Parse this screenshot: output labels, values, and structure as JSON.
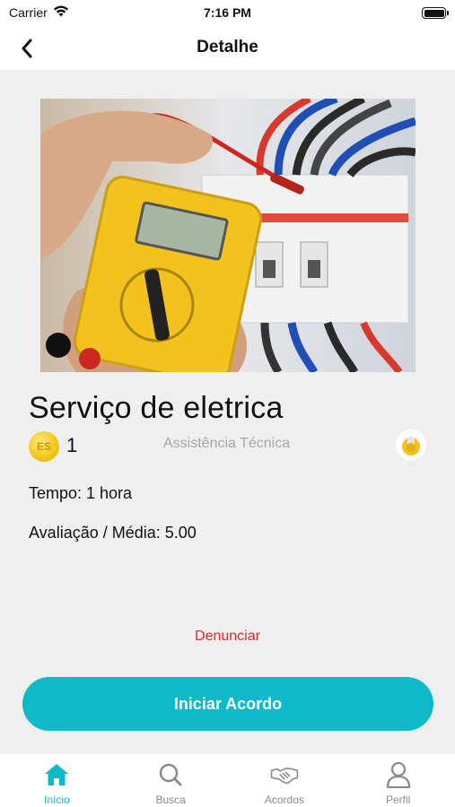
{
  "status_bar": {
    "carrier": "Carrier",
    "time": "7:16 PM"
  },
  "nav": {
    "title": "Detalhe",
    "back_icon": "chevron-left-icon"
  },
  "service": {
    "title": "Serviço de eletrica",
    "coin_label": "ES",
    "coin_value": "1",
    "category": "Assistência Técnica",
    "tempo": "Tempo: 1 hora",
    "avaliacao": "Avaliação / Média: 5.00"
  },
  "actions": {
    "report": "Denunciar",
    "start_agreement": "Iniciar Acordo"
  },
  "tabs": [
    {
      "label": "Início",
      "icon": "home-icon",
      "active": true
    },
    {
      "label": "Busca",
      "icon": "search-icon",
      "active": false
    },
    {
      "label": "Acordos",
      "icon": "handshake-icon",
      "active": false
    },
    {
      "label": "Perfil",
      "icon": "user-icon",
      "active": false
    }
  ],
  "colors": {
    "accent": "#10b9c8",
    "danger": "#e5262b",
    "background": "#efefef",
    "muted": "#a7a7a7"
  }
}
